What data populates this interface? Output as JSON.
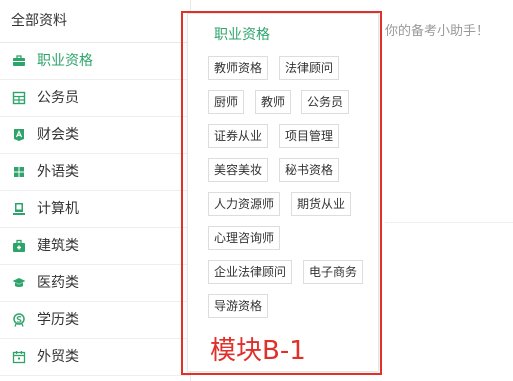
{
  "sidebar": {
    "title": "全部资料",
    "items": [
      {
        "label": "职业资格",
        "icon": "briefcase-icon",
        "active": true
      },
      {
        "label": "公务员",
        "icon": "building-grid-icon",
        "active": false
      },
      {
        "label": "财会类",
        "icon": "accounting-icon",
        "active": false
      },
      {
        "label": "外语类",
        "icon": "windows-icon",
        "active": false
      },
      {
        "label": "计算机",
        "icon": "computer-icon",
        "active": false
      },
      {
        "label": "建筑类",
        "icon": "toolbox-icon",
        "active": false
      },
      {
        "label": "医药类",
        "icon": "graduation-cap-icon",
        "active": false
      },
      {
        "label": "学历类",
        "icon": "diploma-icon",
        "active": false
      },
      {
        "label": "外贸类",
        "icon": "calendar-icon",
        "active": false
      }
    ]
  },
  "background": {
    "welcome_text": "你的备考小助手！"
  },
  "popup": {
    "title": "职业资格",
    "tags": [
      "教师资格",
      "法律顾问",
      "厨师",
      "教师",
      "公务员",
      "证券从业",
      "项目管理",
      "美容美妆",
      "秘书资格",
      "人力资源师",
      "期货从业",
      "心理咨询师",
      "企业法律顾问",
      "电子商务",
      "导游资格"
    ]
  },
  "annotation": {
    "label": "模块B-1",
    "color": "#e0302a"
  },
  "colors": {
    "accent": "#2ea46b",
    "text": "#333333",
    "border": "#dddddd"
  }
}
